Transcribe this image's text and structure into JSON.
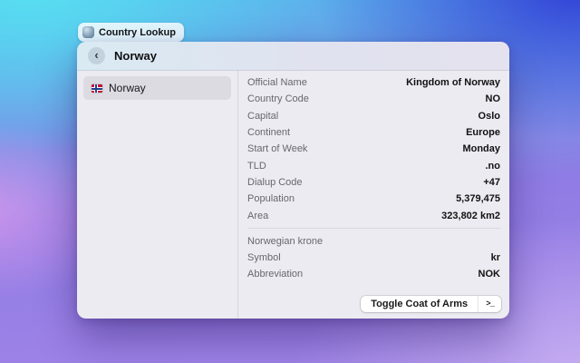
{
  "colors": {
    "bg_top_left": "#58E1F2",
    "bg_top_right": "#2F3CD6",
    "bg_bottom_left": "#9668E2",
    "bg_bottom_right": "#C5ADF1",
    "window_bg": "#ECEBF1",
    "selected_row_bg": "#DCDBE2",
    "flag_red": "#C8102E",
    "flag_blue": "#23408E"
  },
  "tab": {
    "title": "Country Lookup"
  },
  "window": {
    "back_glyph": "‹",
    "title": "Norway",
    "sidebar": {
      "items": [
        {
          "label": "Norway"
        }
      ]
    },
    "details": {
      "rows": [
        {
          "label": "Official Name",
          "value": "Kingdom of Norway"
        },
        {
          "label": "Country Code",
          "value": "NO"
        },
        {
          "label": "Capital",
          "value": "Oslo"
        },
        {
          "label": "Continent",
          "value": "Europe"
        },
        {
          "label": "Start of Week",
          "value": "Monday"
        },
        {
          "label": "TLD",
          "value": ".no"
        },
        {
          "label": "Dialup Code",
          "value": "+47"
        },
        {
          "label": "Population",
          "value": "5,379,475"
        },
        {
          "label": "Area",
          "value": "323,802 km2"
        }
      ],
      "currency": {
        "name": "Norwegian krone",
        "rows": [
          {
            "label": "Symbol",
            "value": "kr"
          },
          {
            "label": "Abbreviation",
            "value": "NOK"
          }
        ]
      }
    },
    "footer": {
      "toggle_label": "Toggle Coat of Arms",
      "terminal_glyph": ">_"
    }
  }
}
